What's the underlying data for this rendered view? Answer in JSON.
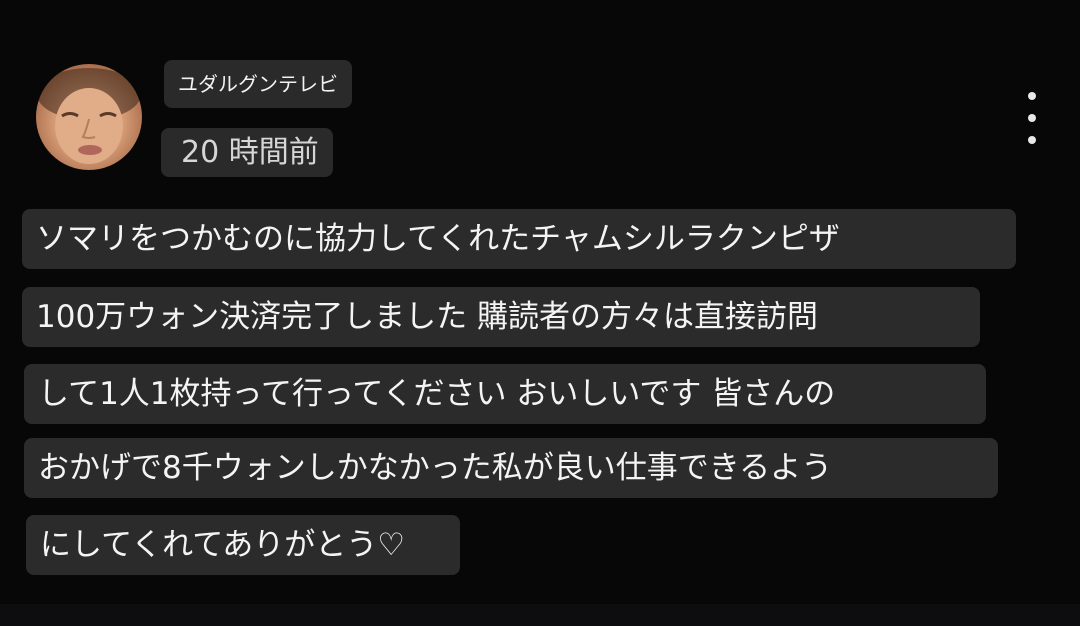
{
  "comment": {
    "author": "ユダルグンテレビ",
    "timestamp": "20 時間前",
    "lines": [
      "ソマリをつかむのに協力してくれたチャムシルラクンピザ",
      "100万ウォン決済完了しました 購読者の方々は直接訪問",
      "して1人1枚持って行ってください おいしいです 皆さんの",
      "おかげで8千ウォンしかなかった私が良い仕事できるよう",
      "にしてくれてありがとう♡"
    ],
    "menu_icon": "more-vertical-icon"
  }
}
